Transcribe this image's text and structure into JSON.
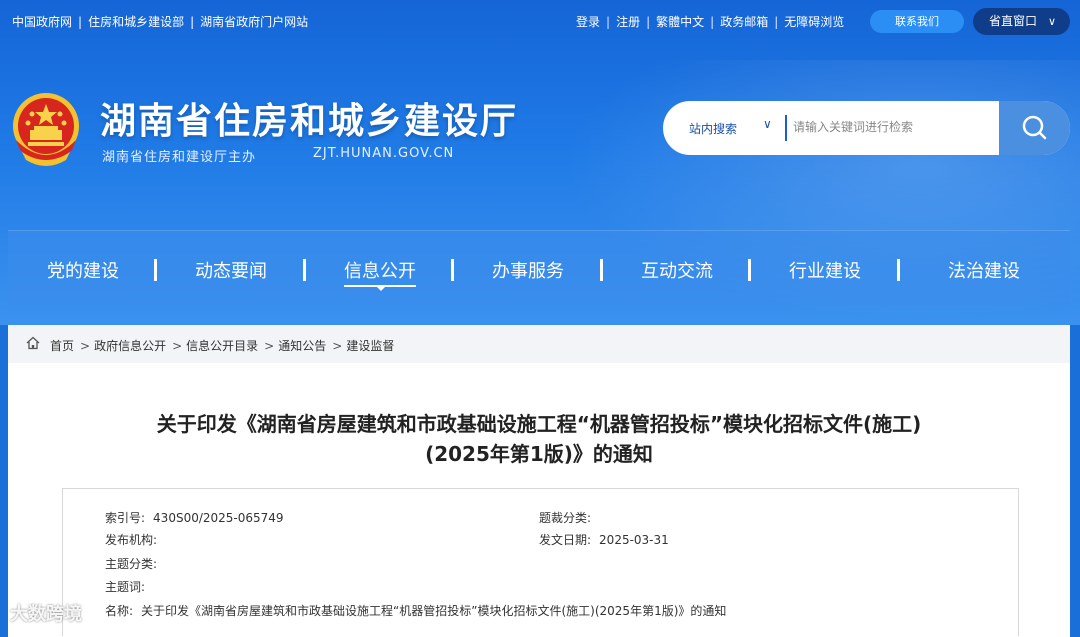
{
  "topbar": {
    "left_links": [
      "中国政府网",
      "住房和城乡建设部",
      "湖南省政府门户网站"
    ],
    "right_links": [
      "登录",
      "注册",
      "繁體中文",
      "政务邮箱",
      "无障碍浏览"
    ],
    "contact_label": "联系我们",
    "window_label": "省直窗口"
  },
  "header": {
    "title": "湖南省住房和城乡建设厅",
    "sponsor": "湖南省住房和建设厅主办",
    "domain": "ZJT.HUNAN.GOV.CN"
  },
  "search": {
    "scope": "站内搜索",
    "placeholder": "请输入关键词进行检索"
  },
  "nav": {
    "items": [
      "党的建设",
      "动态要闻",
      "信息公开",
      "办事服务",
      "互动交流",
      "行业建设",
      "法治建设"
    ],
    "active": "信息公开"
  },
  "breadcrumb": {
    "items": [
      "首页",
      "政府信息公开",
      "信息公开目录",
      "通知公告",
      "建设监督"
    ]
  },
  "article": {
    "title_line1": "关于印发《湖南省房屋建筑和市政基础设施工程“机器管招投标”模块化招标文件(施工)",
    "title_line2": "(2025年第1版)》的通知",
    "meta": {
      "index_label": "索引号:",
      "index_value": "430S00/2025-065749",
      "category_label": "题裁分类:",
      "category_value": "",
      "publisher_label": "发布机构:",
      "publisher_value": "",
      "date_label": "发文日期:",
      "date_value": "2025-03-31",
      "topic_label": "主题分类:",
      "topic_value": "",
      "keyword_label": "主题词:",
      "keyword_value": "",
      "name_label": "名称:",
      "name_value": "关于印发《湖南省房屋建筑和市政基础设施工程“机器管招投标”模块化招标文件(施工)(2025年第1版)》的通知"
    }
  },
  "watermark": "大数跨境",
  "colors": {
    "header_blue": "#1f7ae6",
    "nav_blue": "#3c8ceb",
    "window_pill": "#0f3d8a",
    "contact_pill": "#2b8ef5"
  }
}
